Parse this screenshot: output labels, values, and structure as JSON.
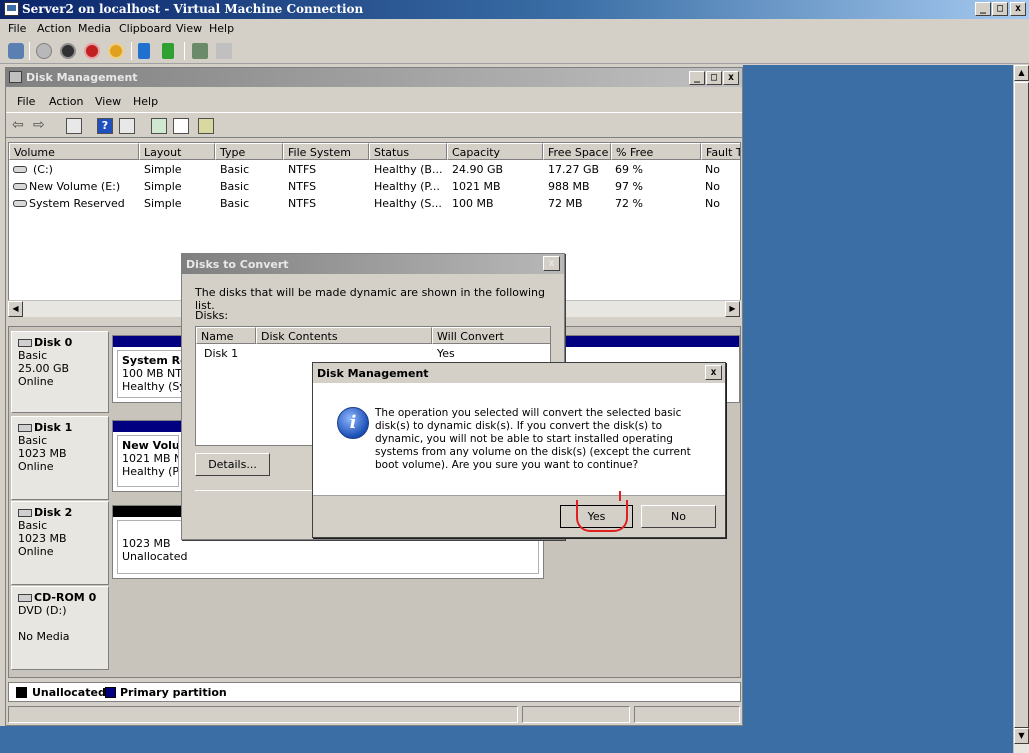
{
  "vm": {
    "title": "Server2 on localhost - Virtual Machine Connection",
    "menu": [
      "File",
      "Action",
      "Media",
      "Clipboard",
      "View",
      "Help"
    ],
    "caption_minimize": "_",
    "caption_maximize": "□",
    "caption_close": "x"
  },
  "dm": {
    "title": "Disk Management",
    "menu": [
      "File",
      "Action",
      "View",
      "Help"
    ],
    "columns": [
      "Volume",
      "Layout",
      "Type",
      "File System",
      "Status",
      "Capacity",
      "Free Space",
      "% Free",
      "Fault T"
    ],
    "volumes": [
      {
        "volume": "(C:)",
        "layout": "Simple",
        "type": "Basic",
        "fs": "NTFS",
        "status": "Healthy (B...",
        "capacity": "24.90 GB",
        "free": "17.27 GB",
        "pct": "69 %",
        "fault": "No"
      },
      {
        "volume": "New Volume (E:)",
        "layout": "Simple",
        "type": "Basic",
        "fs": "NTFS",
        "status": "Healthy (P...",
        "capacity": "1021 MB",
        "free": "988 MB",
        "pct": "97 %",
        "fault": "No"
      },
      {
        "volume": "System Reserved",
        "layout": "Simple",
        "type": "Basic",
        "fs": "NTFS",
        "status": "Healthy (S...",
        "capacity": "100 MB",
        "free": "72 MB",
        "pct": "72 %",
        "fault": "No"
      }
    ],
    "disks": [
      {
        "name": "Disk 0",
        "kind": "Basic",
        "size": "25.00 GB",
        "state": "Online",
        "part_title": "System Res",
        "part_line1": "100 MB NTFS",
        "part_line2": "Healthy (Syst"
      },
      {
        "name": "Disk 1",
        "kind": "Basic",
        "size": "1023 MB",
        "state": "Online",
        "part_title": "New Volume",
        "part_line1": "1021 MB NTF",
        "part_line2": "Healthy (Prim"
      },
      {
        "name": "Disk 2",
        "kind": "Basic",
        "size": "1023 MB",
        "state": "Online",
        "part_line1": "1023 MB",
        "part_line2": "Unallocated"
      }
    ],
    "cdrom": {
      "name": "CD-ROM 0",
      "drive": "DVD (D:)",
      "media": "No Media"
    },
    "legend": {
      "unallocated": "Unallocated",
      "primary": "Primary partition"
    },
    "colors": {
      "primary": "#000080",
      "unallocated": "#000000",
      "desktop": "#3a6ea5"
    }
  },
  "convert": {
    "title": "Disks to Convert",
    "intro": "The disks that will be made dynamic are shown in the following list.",
    "disks_label": "Disks:",
    "columns": [
      "Name",
      "Disk Contents",
      "Will Convert"
    ],
    "rows": [
      {
        "name": "Disk 1",
        "contents": "",
        "will": "Yes"
      }
    ],
    "details_button": "Details..."
  },
  "confirm": {
    "title": "Disk Management",
    "icon": "info-icon",
    "message": "The operation you selected will convert the selected basic disk(s) to dynamic disk(s). If you convert the disk(s) to dynamic, you will not be able to start installed operating systems from any volume on the disk(s) (except the current boot volume). Are you sure you want to continue?",
    "yes": "Yes",
    "no": "No",
    "close": "x"
  }
}
